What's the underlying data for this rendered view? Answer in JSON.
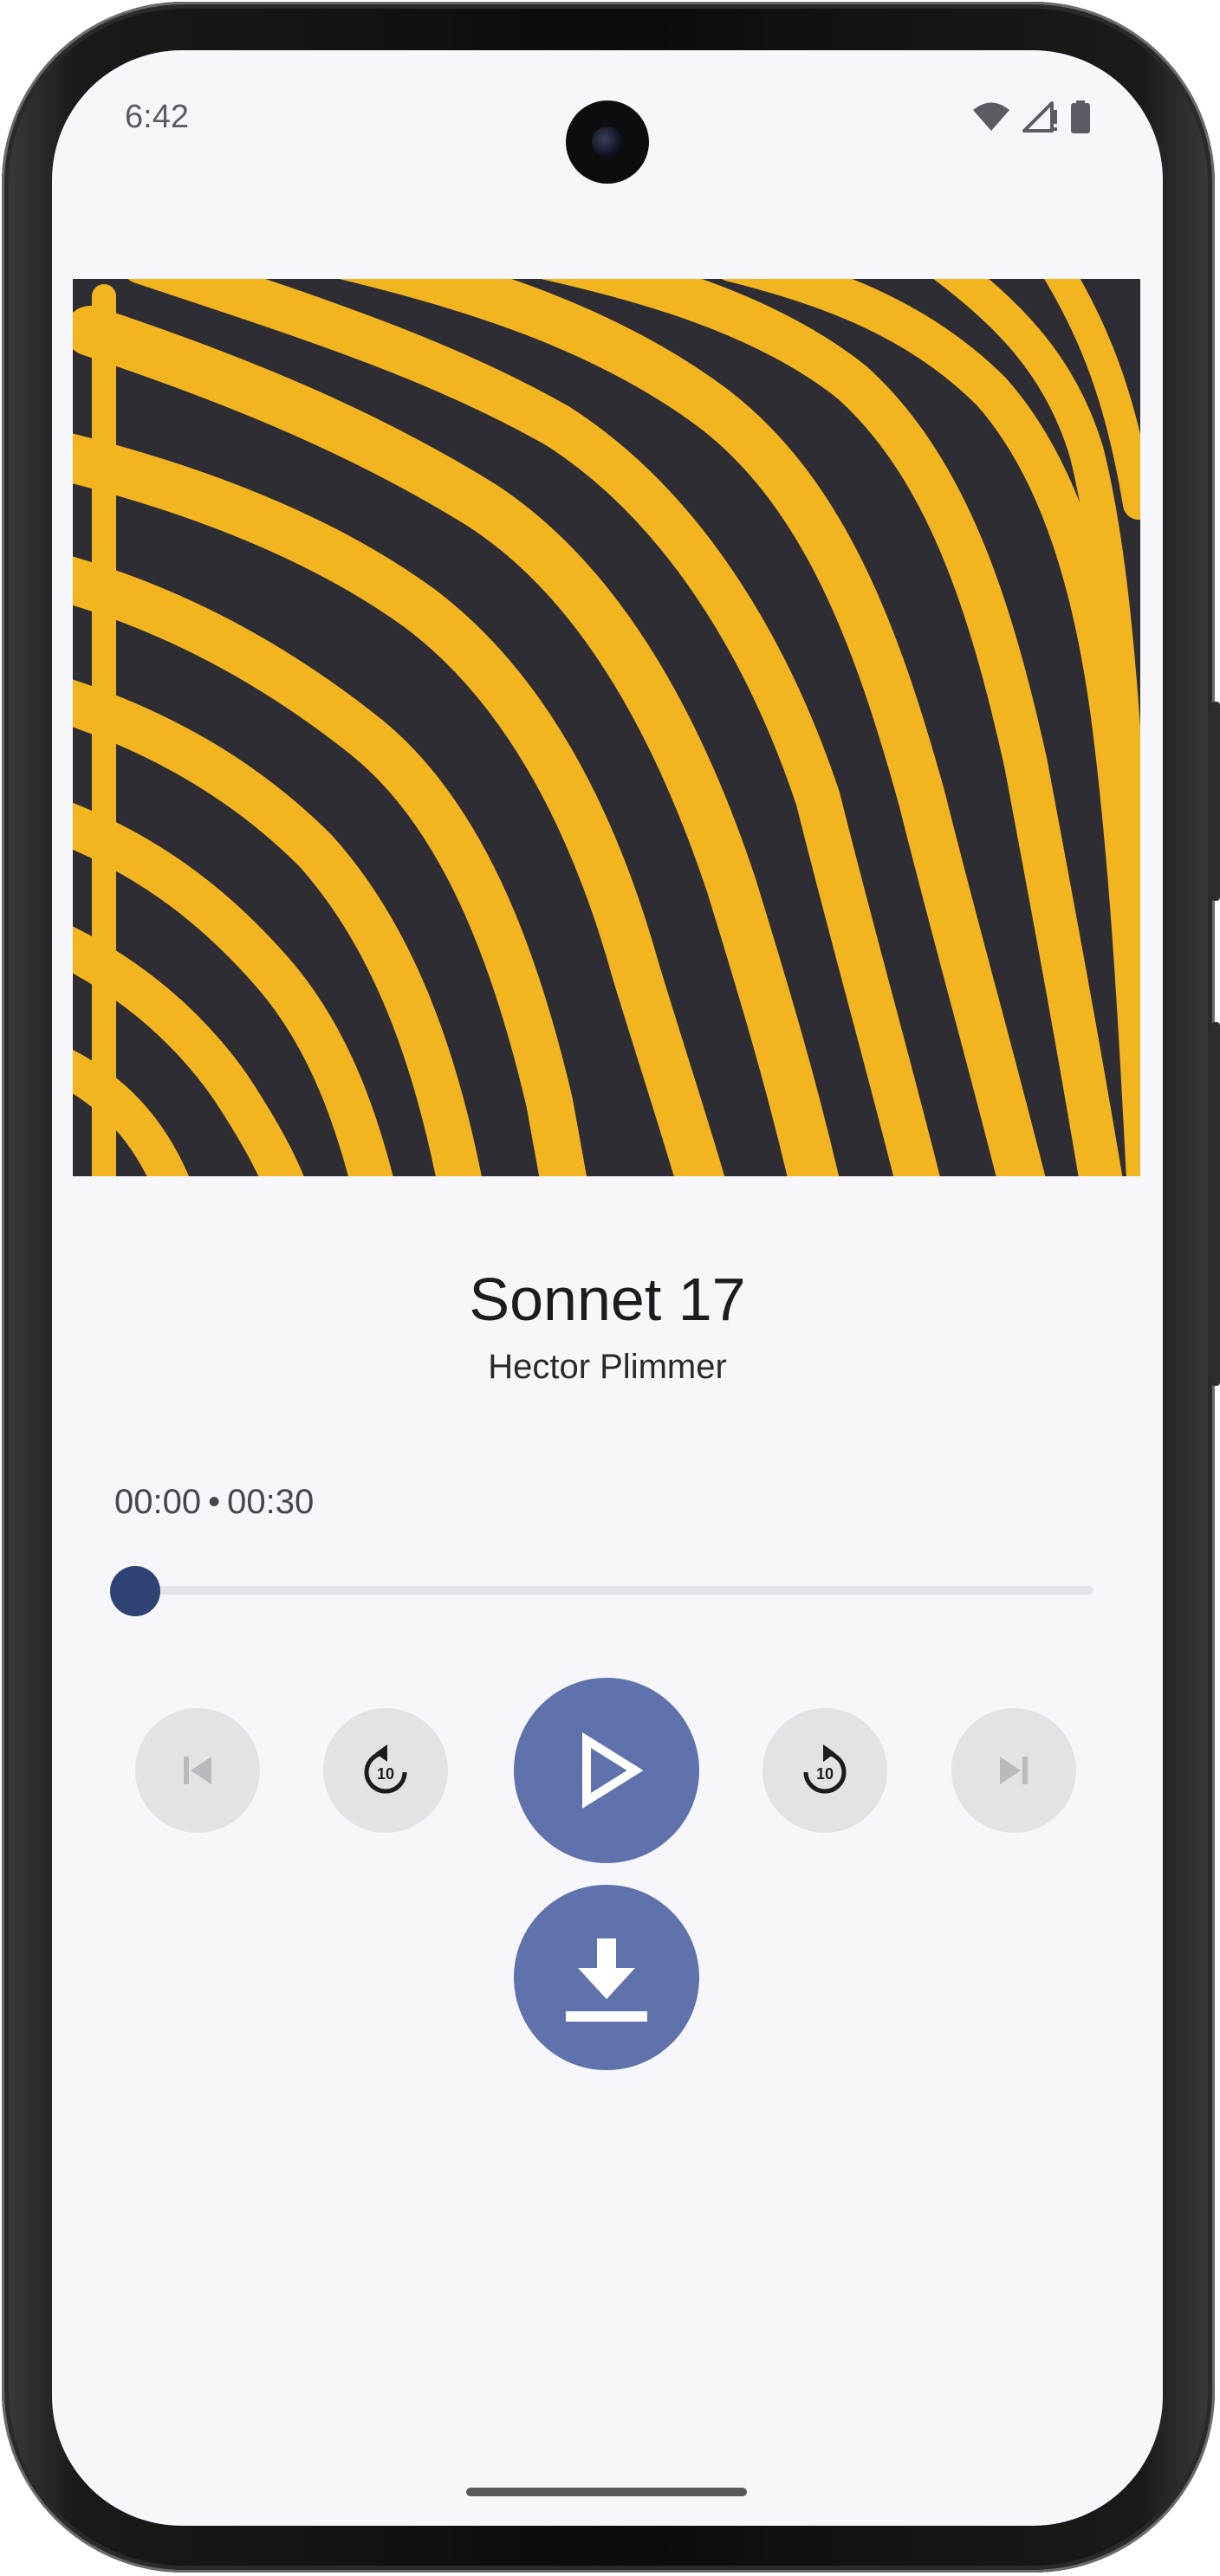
{
  "status_bar": {
    "time": "6:42"
  },
  "player": {
    "title": "Sonnet 17",
    "artist": "Hector Plimmer",
    "current_time": "00:00",
    "separator": "•",
    "duration": "00:30",
    "progress": 0
  },
  "controls": {
    "previous": {
      "icon": "skip-previous-icon",
      "enabled": false
    },
    "rewind": {
      "icon": "replay-10-icon",
      "seconds_label": "10"
    },
    "play": {
      "icon": "play-icon"
    },
    "forward": {
      "icon": "forward-10-icon",
      "seconds_label": "10"
    },
    "next": {
      "icon": "skip-next-icon",
      "enabled": false
    },
    "download": {
      "icon": "download-icon"
    }
  },
  "colors": {
    "background": "#f6f6fb",
    "accent": "#5f72ab",
    "thumb": "#2f4273",
    "cover_yellow": "#f2b41f",
    "cover_dark": "#2d2d33"
  }
}
